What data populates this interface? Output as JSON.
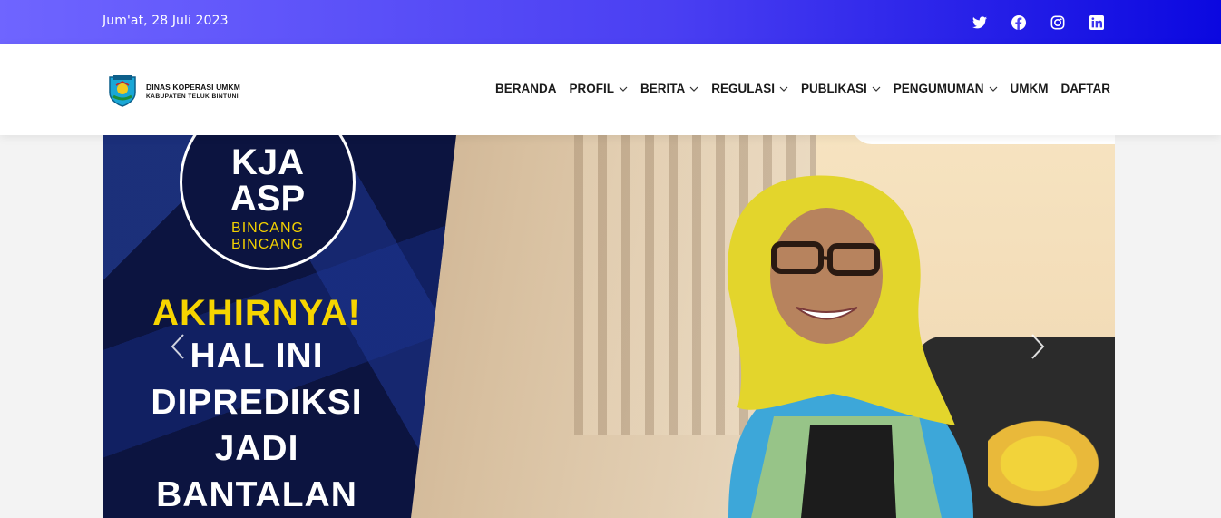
{
  "topbar": {
    "date": "Jum'at, 28 Juli 2023",
    "social": [
      "twitter-icon",
      "facebook-icon",
      "instagram-icon",
      "linkedin-icon"
    ],
    "colors": {
      "gradient_start": "#6f65ff",
      "gradient_end": "#0b08e0"
    }
  },
  "brand": {
    "title": "DINAS KOPERASI UMKM",
    "subtitle": "KABUPATEN TELUK BINTUNI"
  },
  "nav": {
    "items": [
      {
        "label": "BERANDA",
        "dropdown": false
      },
      {
        "label": "PROFIL",
        "dropdown": true
      },
      {
        "label": "BERITA",
        "dropdown": true
      },
      {
        "label": "REGULASI",
        "dropdown": true
      },
      {
        "label": "PUBLIKASI",
        "dropdown": true
      },
      {
        "label": "PENGUMUMAN",
        "dropdown": true
      },
      {
        "label": "UMKM",
        "dropdown": false
      },
      {
        "label": "DAFTAR",
        "dropdown": false
      }
    ]
  },
  "hero": {
    "badge": {
      "line1": "KJA",
      "line2": "ASP",
      "line3": "BINCANG",
      "line4": "BINCANG"
    },
    "headline": [
      "AKHIRNYA!",
      "HAL INI",
      "DIPREDIKSI",
      "JADI",
      "BANTALAN"
    ],
    "controls": {
      "prev": "chevron-left-icon",
      "next": "chevron-right-icon"
    }
  }
}
